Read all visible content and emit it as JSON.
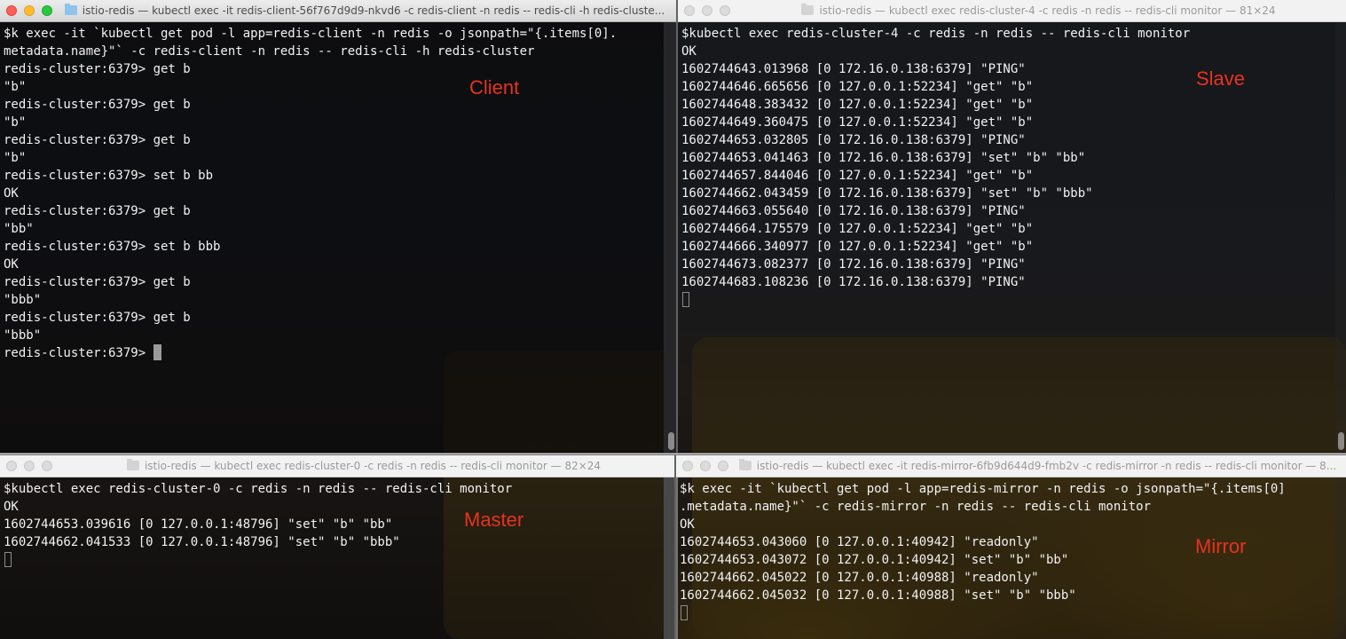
{
  "windows": {
    "client": {
      "title": "istio-redis — kubectl exec -it redis-client-56f767d9d9-nkvd6 -c redis-client -n redis -- redis-cli -h redis-cluste...",
      "label": "Client",
      "lines": [
        "$k exec -it `kubectl get pod -l app=redis-client -n redis -o jsonpath=\"{.items[0].",
        "metadata.name}\"` -c redis-client -n redis -- redis-cli -h redis-cluster",
        "redis-cluster:6379> get b",
        "\"b\"",
        "redis-cluster:6379> get b",
        "\"b\"",
        "redis-cluster:6379> get b",
        "\"b\"",
        "redis-cluster:6379> set b bb",
        "OK",
        "redis-cluster:6379> get b",
        "\"bb\"",
        "redis-cluster:6379> set b bbb",
        "OK",
        "redis-cluster:6379> get b",
        "\"bbb\"",
        "redis-cluster:6379> get b",
        "\"bbb\""
      ],
      "prompt": "redis-cluster:6379> "
    },
    "slave": {
      "title": "istio-redis — kubectl exec redis-cluster-4 -c redis -n redis -- redis-cli monitor — 81×24",
      "label": "Slave",
      "lines": [
        "$kubectl exec redis-cluster-4 -c redis -n redis -- redis-cli monitor",
        "OK",
        "1602744643.013968 [0 172.16.0.138:6379] \"PING\"",
        "1602744646.665656 [0 127.0.0.1:52234] \"get\" \"b\"",
        "1602744648.383432 [0 127.0.0.1:52234] \"get\" \"b\"",
        "1602744649.360475 [0 127.0.0.1:52234] \"get\" \"b\"",
        "1602744653.032805 [0 172.16.0.138:6379] \"PING\"",
        "1602744653.041463 [0 172.16.0.138:6379] \"set\" \"b\" \"bb\"",
        "1602744657.844046 [0 127.0.0.1:52234] \"get\" \"b\"",
        "1602744662.043459 [0 172.16.0.138:6379] \"set\" \"b\" \"bbb\"",
        "1602744663.055640 [0 172.16.0.138:6379] \"PING\"",
        "1602744664.175579 [0 127.0.0.1:52234] \"get\" \"b\"",
        "1602744666.340977 [0 127.0.0.1:52234] \"get\" \"b\"",
        "1602744673.082377 [0 172.16.0.138:6379] \"PING\"",
        "1602744683.108236 [0 172.16.0.138:6379] \"PING\""
      ]
    },
    "master": {
      "title": "istio-redis — kubectl exec redis-cluster-0 -c redis -n redis -- redis-cli monitor — 82×24",
      "label": "Master",
      "lines": [
        "$kubectl exec redis-cluster-0 -c redis -n redis -- redis-cli monitor",
        "OK",
        "1602744653.039616 [0 127.0.0.1:48796] \"set\" \"b\" \"bb\"",
        "1602744662.041533 [0 127.0.0.1:48796] \"set\" \"b\" \"bbb\""
      ]
    },
    "mirror": {
      "title": "istio-redis — kubectl exec -it redis-mirror-6fb9d644d9-fmb2v -c redis-mirror -n redis -- redis-cli monitor — 8...",
      "label": "Mirror",
      "lines": [
        "$k exec -it `kubectl get pod -l app=redis-mirror -n redis -o jsonpath=\"{.items[0]",
        ".metadata.name}\"` -c redis-mirror -n redis -- redis-cli monitor",
        "OK",
        "1602744653.043060 [0 127.0.0.1:40942] \"readonly\"",
        "1602744653.043072 [0 127.0.0.1:40942] \"set\" \"b\" \"bb\"",
        "1602744662.045022 [0 127.0.0.1:40988] \"readonly\"",
        "1602744662.045032 [0 127.0.0.1:40988] \"set\" \"b\" \"bbb\""
      ]
    }
  },
  "colors": {
    "label_red": "#e8321f",
    "terminal_text": "#f2f2f2",
    "traffic_red": "#fe5f57",
    "traffic_yellow": "#febc2e",
    "traffic_green": "#28c840"
  }
}
